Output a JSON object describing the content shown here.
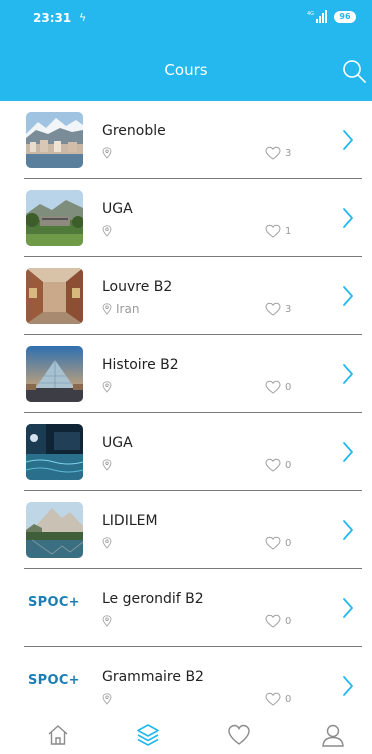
{
  "status_bar": {
    "time": "23:31",
    "battery": "96"
  },
  "header": {
    "title": "Cours"
  },
  "courses": [
    {
      "title": "Grenoble",
      "location": "",
      "likes": "3",
      "thumb": "city-mountains"
    },
    {
      "title": "UGA",
      "location": "",
      "likes": "1",
      "thumb": "campus"
    },
    {
      "title": "Louvre B2",
      "location": "Iran",
      "likes": "3",
      "thumb": "gallery"
    },
    {
      "title": "Histoire B2",
      "location": "",
      "likes": "0",
      "thumb": "pyramid"
    },
    {
      "title": "UGA",
      "location": "",
      "likes": "0",
      "thumb": "night-pool"
    },
    {
      "title": "LIDILEM",
      "location": "",
      "likes": "0",
      "thumb": "lake-mountain"
    },
    {
      "title": "Le gerondif B2",
      "location": "",
      "likes": "0",
      "thumb": "spoc-logo"
    },
    {
      "title": "Grammaire B2",
      "location": "",
      "likes": "0",
      "thumb": "spoc-logo"
    }
  ],
  "spoc_logo_text": "SPOC+",
  "colors": {
    "accent": "#24b8ef",
    "nav_active": "#24b8ef",
    "muted": "#9a9a9a"
  },
  "bottom_nav": [
    {
      "icon": "home-icon",
      "active": false
    },
    {
      "icon": "layers-icon",
      "active": true
    },
    {
      "icon": "heart-icon",
      "active": false
    },
    {
      "icon": "user-icon",
      "active": false
    }
  ]
}
